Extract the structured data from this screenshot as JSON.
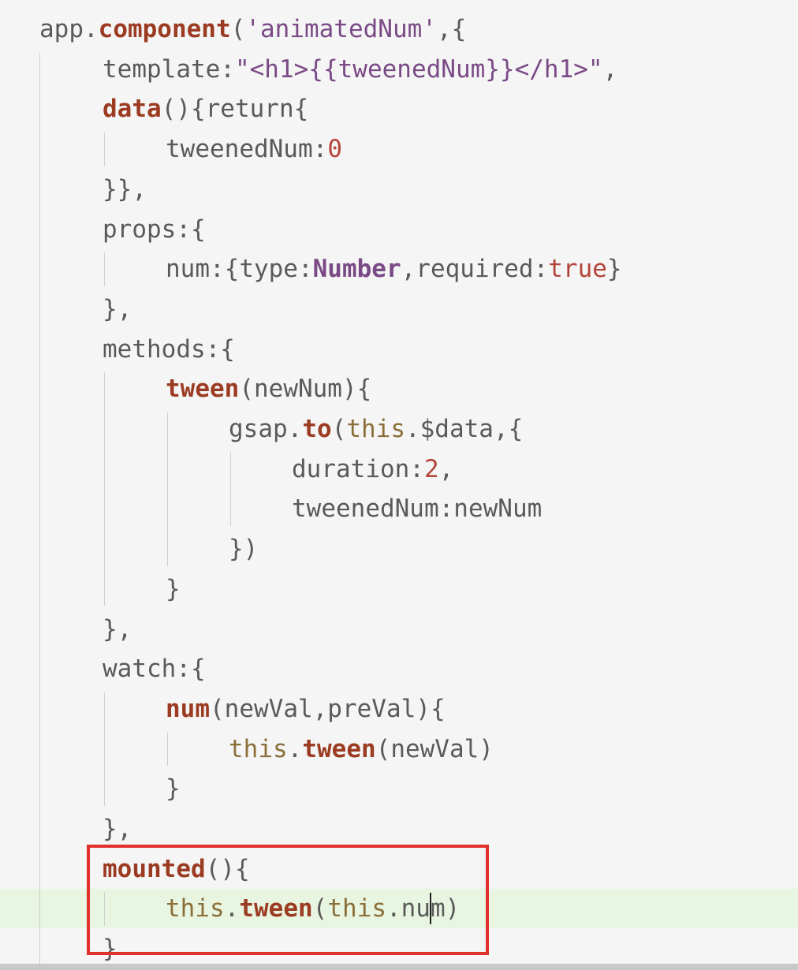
{
  "editor": {
    "highlight_color": "#e8f5e0",
    "annotation_color": "#e0312d",
    "lines": [
      {
        "indent": 1,
        "tokens": [
          {
            "t": "app.",
            "c": "pl"
          },
          {
            "t": "component",
            "c": "kw"
          },
          {
            "t": "(",
            "c": "pl"
          },
          {
            "t": "'animatedNum'",
            "c": "str"
          },
          {
            "t": ",{",
            "c": "pl"
          }
        ]
      },
      {
        "indent": 2,
        "tokens": [
          {
            "t": "template:",
            "c": "pl"
          },
          {
            "t": "\"<h1>{{tweenedNum}}</h1>\"",
            "c": "str"
          },
          {
            "t": ",",
            "c": "pl"
          }
        ]
      },
      {
        "indent": 2,
        "tokens": [
          {
            "t": "data",
            "c": "kw"
          },
          {
            "t": "(){return{",
            "c": "pl"
          }
        ]
      },
      {
        "indent": 3,
        "tokens": [
          {
            "t": "tweenedNum:",
            "c": "pl"
          },
          {
            "t": "0",
            "c": "num"
          }
        ]
      },
      {
        "indent": 2,
        "tokens": [
          {
            "t": "}},",
            "c": "pl"
          }
        ]
      },
      {
        "indent": 2,
        "tokens": [
          {
            "t": "props:{",
            "c": "pl"
          }
        ]
      },
      {
        "indent": 3,
        "tokens": [
          {
            "t": "num:{type:",
            "c": "pl"
          },
          {
            "t": "Number",
            "c": "ty"
          },
          {
            "t": ",required:",
            "c": "pl"
          },
          {
            "t": "true",
            "c": "num"
          },
          {
            "t": "}",
            "c": "pl"
          }
        ]
      },
      {
        "indent": 2,
        "tokens": [
          {
            "t": "},",
            "c": "pl"
          }
        ]
      },
      {
        "indent": 2,
        "tokens": [
          {
            "t": "methods:{",
            "c": "pl"
          }
        ]
      },
      {
        "indent": 3,
        "tokens": [
          {
            "t": "tween",
            "c": "kw"
          },
          {
            "t": "(newNum){",
            "c": "pl"
          }
        ]
      },
      {
        "indent": 4,
        "tokens": [
          {
            "t": "gsap.",
            "c": "pl"
          },
          {
            "t": "to",
            "c": "kw"
          },
          {
            "t": "(",
            "c": "pl"
          },
          {
            "t": "this",
            "c": "th"
          },
          {
            "t": ".$data,{",
            "c": "pl"
          }
        ]
      },
      {
        "indent": 5,
        "tokens": [
          {
            "t": "duration:",
            "c": "pl"
          },
          {
            "t": "2",
            "c": "num"
          },
          {
            "t": ",",
            "c": "pl"
          }
        ]
      },
      {
        "indent": 5,
        "tokens": [
          {
            "t": "tweenedNum:newNum",
            "c": "pl"
          }
        ]
      },
      {
        "indent": 4,
        "tokens": [
          {
            "t": "})",
            "c": "pl"
          }
        ]
      },
      {
        "indent": 3,
        "tokens": [
          {
            "t": "}",
            "c": "pl"
          }
        ]
      },
      {
        "indent": 2,
        "tokens": [
          {
            "t": "},",
            "c": "pl"
          }
        ]
      },
      {
        "indent": 2,
        "tokens": [
          {
            "t": "watch:{",
            "c": "pl"
          }
        ]
      },
      {
        "indent": 3,
        "tokens": [
          {
            "t": "num",
            "c": "kw"
          },
          {
            "t": "(newVal,preVal){",
            "c": "pl"
          }
        ]
      },
      {
        "indent": 4,
        "tokens": [
          {
            "t": "this",
            "c": "th"
          },
          {
            "t": ".",
            "c": "pl"
          },
          {
            "t": "tween",
            "c": "kw"
          },
          {
            "t": "(newVal)",
            "c": "pl"
          }
        ]
      },
      {
        "indent": 3,
        "tokens": [
          {
            "t": "}",
            "c": "pl"
          }
        ]
      },
      {
        "indent": 2,
        "tokens": [
          {
            "t": "},",
            "c": "pl"
          }
        ]
      },
      {
        "indent": 2,
        "tokens": [
          {
            "t": "mounted",
            "c": "kw"
          },
          {
            "t": "(){",
            "c": "pl"
          }
        ]
      },
      {
        "indent": 3,
        "highlight": true,
        "tokens": [
          {
            "t": "this",
            "c": "th"
          },
          {
            "t": ".",
            "c": "pl"
          },
          {
            "t": "tween",
            "c": "kw"
          },
          {
            "t": "(",
            "c": "pl"
          },
          {
            "t": "this",
            "c": "th"
          },
          {
            "t": ".nu",
            "c": "pl"
          },
          {
            "t": "m)",
            "c": "pl"
          }
        ]
      },
      {
        "indent": 2,
        "tokens": [
          {
            "t": "}",
            "c": "pl"
          }
        ]
      }
    ]
  }
}
